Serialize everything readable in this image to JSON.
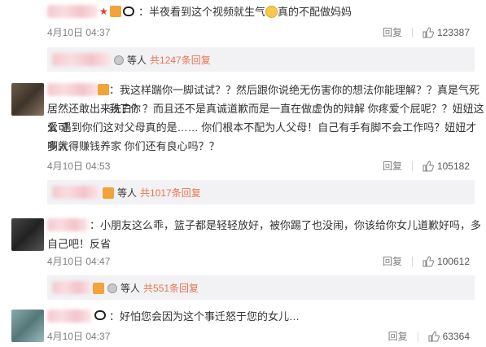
{
  "comments": [
    {
      "text": "：半夜看到这个视频就生气",
      "text_after_emoji": "真的不配做妈妈",
      "date": "4月10日 04:37",
      "reply_label": "回复",
      "likes": "123387",
      "reply_summary": {
        "prefix": "等人",
        "more": "共1247条回复"
      }
    },
    {
      "lines": [
        "：我这样踹你一脚试试？？然后跟你说绝无伤害你的想法你能理解？？真是气死我了你",
        "居然还敢出来洗白？？而且还不是真诚道歉而是一直在做虚伪的辩解 你疼爱个屁呢？？妞妞这么可",
        "爱 遇到你们这对父母真的是…… 你们根本不配为人父母！自己有手有脚不会工作吗？妞妞才多大",
        "啊就得赚钱养家 你们还有良心吗？？"
      ],
      "date": "4月10日 04:53",
      "reply_label": "回复",
      "likes": "105182",
      "reply_summary": {
        "prefix": "等人",
        "more": "共1017条回复"
      }
    },
    {
      "lines": [
        "：小朋友这么乖，篮子都是轻轻放好，被你踢了也没闹，你该给你女儿道歉好吗，多反省",
        "自己吧！"
      ],
      "date": "4月10日 04:47",
      "reply_label": "回复",
      "likes": "100612",
      "reply_summary": {
        "prefix": "等人",
        "more": "共551条回复"
      }
    },
    {
      "text": "：好怕您会因为这个事迁怒于您的女儿…",
      "date": "4月10日 04:37",
      "reply_label": "回复",
      "likes": "63364"
    }
  ],
  "icons": {
    "like": "thumb-up-icon",
    "verified": "verified-badge-icon",
    "panda": "panda-emoji-icon",
    "level": "member-level-icon",
    "star": "star-icon"
  }
}
